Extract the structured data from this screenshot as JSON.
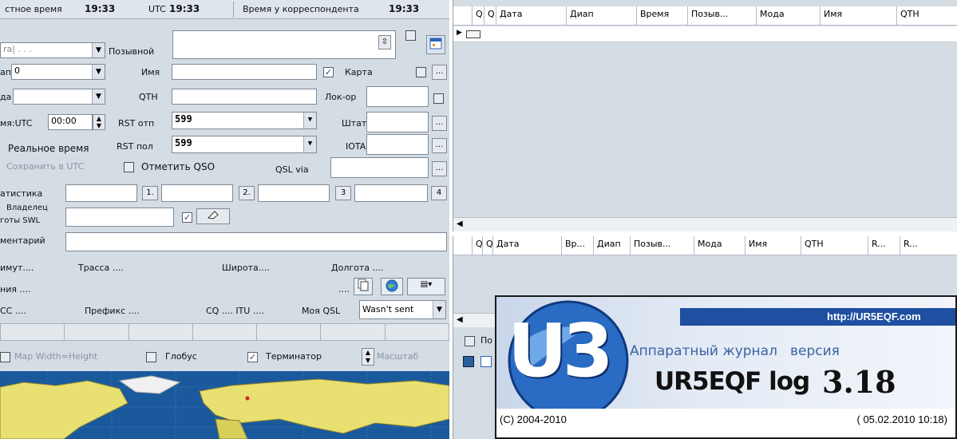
{
  "top": {
    "local_time_label": "стное время",
    "local_time": "19:33",
    "utc_label": "UTC",
    "utc_time": "19:33",
    "corr_time_label": "Время у корреспондента",
    "corr_time": "19:33"
  },
  "form": {
    "callsign_label": "Позывной",
    "band_label": "ап",
    "band_value": "0",
    "mode_label": "да",
    "name_label": "Имя",
    "qth_label": "QTH",
    "map_checkbox_label": "Карта",
    "locator_label": "Лок-ор",
    "time_label": "мя:UTC",
    "time_value": "00:00",
    "rst_sent_label": "RST отп",
    "rst_sent_value": "599",
    "state_label": "Штат",
    "realtime_label": "Реальное время",
    "rst_rcvd_label": "RST пол",
    "rst_rcvd_value": "599",
    "iota_label": "IOTA",
    "save_utc_label": "Сохранить в UTC",
    "mark_qso_label": "Отметить QSO",
    "qsl_via_label": "QSL via",
    "stats_label": "атистика",
    "stats_btn1": "1.",
    "stats_btn2": "2.",
    "stats_btn3": "3",
    "stats_btn4": "4",
    "swl_label_1": "Владелец",
    "swl_label_2": "готы SWL",
    "comment_label": "ментарий",
    "azimuth_label": "имут....",
    "path_label": "Трасса ....",
    "lat_label": "Широта....",
    "lon_label": "Долгота ....",
    "name2_label": "ния ....",
    "dots_label": "....",
    "dxcc_label": "CC ....",
    "prefix_label": "Префикс ....",
    "cq_label": "CQ .... ITU ....",
    "my_qsl_label": "Моя QSL",
    "my_qsl_value": "Wasn't sent",
    "map_wh_label": "Map Width=Height",
    "globe_label": "Глобус",
    "terminator_label": "Терминатор",
    "scale_label": "Масштаб"
  },
  "grid1": {
    "headers": [
      "Q.",
      "Q.",
      "Дата",
      "Диап",
      "Время",
      "Позыв...",
      "Мода",
      "Имя",
      "QTH"
    ]
  },
  "grid2": {
    "headers": [
      "Q",
      "Q",
      "Дата",
      "Вр...",
      "Диап",
      "Позыв...",
      "Мода",
      "Имя",
      "QTH",
      "R...",
      "R..."
    ]
  },
  "bottom_left": {
    "po_label": "По"
  },
  "splash": {
    "url": "http://UR5EQF.com",
    "logo": "U3",
    "subtitle": "Аппаратный журнал",
    "version_label": "версия",
    "app_name": "UR5EQF log",
    "version": "3.18",
    "copyright": "(C) 2004-2010",
    "build_date": "( 05.02.2010 10:18)"
  },
  "colors": {
    "panel_bg": "#d4dce4",
    "splash_blue": "#1e4fa0",
    "map_ocean": "#1a5a9c",
    "map_land": "#e8e070"
  }
}
